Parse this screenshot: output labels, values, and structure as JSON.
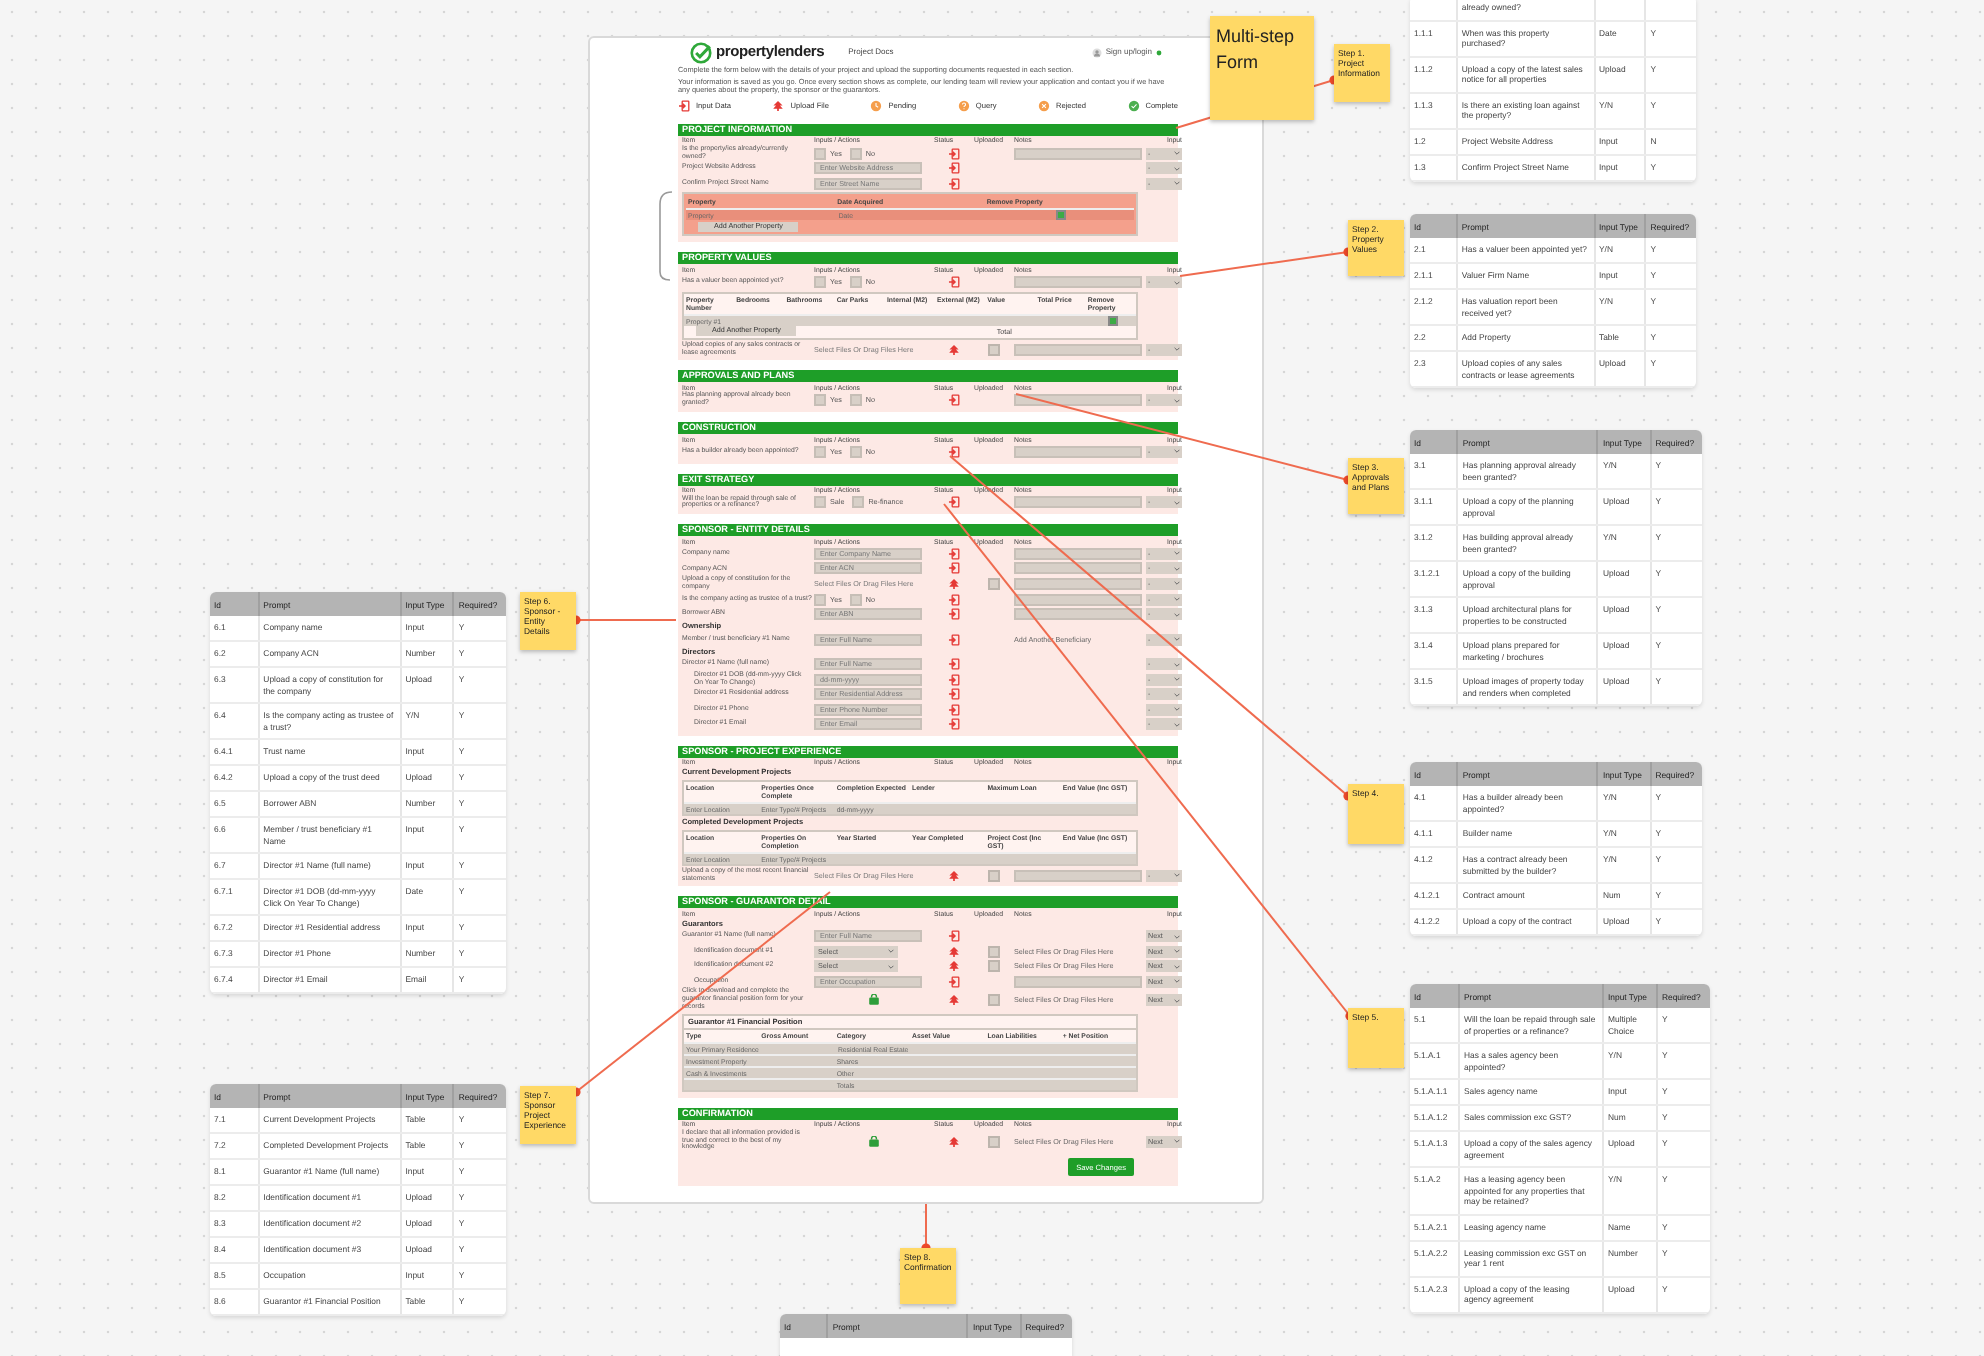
{
  "sticky_notes": [
    {
      "text": "Multi-step Form",
      "kind": "large"
    },
    {
      "text": "Step 1. Project Information",
      "kind": "small"
    },
    {
      "text": "Step 2. Property Values",
      "kind": "small"
    },
    {
      "text": "Step 3. Approvals and Plans",
      "kind": "small"
    },
    {
      "text": "Step 4.",
      "kind": "small"
    },
    {
      "text": "Step 5.",
      "kind": "small"
    },
    {
      "text": "Step 6. Sponsor - Entity Details",
      "kind": "small"
    },
    {
      "text": "Step 7. Sponsor Project Experience",
      "kind": "small"
    },
    {
      "text": "Step 8. Confirmation",
      "kind": "small"
    }
  ],
  "spec_tables": [
    {
      "rows": [
        [
          "",
          "already owned?",
          "",
          ""
        ],
        [
          "1.1.1",
          "When was this property purchased?",
          "Date",
          "Y"
        ],
        [
          "1.1.2",
          "Upload a copy of the latest sales notice for all properties",
          "Upload",
          "Y"
        ],
        [
          "1.1.3",
          "Is there an existing loan against the property?",
          "Y/N",
          "Y"
        ],
        [
          "1.2",
          "Project Website Address",
          "Input",
          "N"
        ],
        [
          "1.3",
          "Confirm Project Street Name",
          "Input",
          "Y"
        ]
      ]
    },
    {
      "columns": [
        "Id",
        "Prompt",
        "Input Type",
        "Required?"
      ],
      "rows": [
        [
          "2.1",
          "Has a valuer been appointed yet?",
          "Y/N",
          "Y"
        ],
        [
          "2.1.1",
          "Valuer Firm Name",
          "Input",
          "Y"
        ],
        [
          "2.1.2",
          "Has valuation report been received yet?",
          "Y/N",
          "Y"
        ],
        [
          "2.2",
          "Add Property",
          "Table",
          "Y"
        ],
        [
          "2.3",
          "Upload copies of any sales contracts or lease agreements",
          "Upload",
          "Y"
        ]
      ]
    },
    {
      "columns": [
        "Id",
        "Prompt",
        "Input Type",
        "Required?"
      ],
      "rows": [
        [
          "3.1",
          "Has planning approval already been granted?",
          "Y/N",
          "Y"
        ],
        [
          "3.1.1",
          "Upload a copy of the planning approval",
          "Upload",
          "Y"
        ],
        [
          "3.1.2",
          "Has building approval already been granted?",
          "Y/N",
          "Y"
        ],
        [
          "3.1.2.1",
          "Upload a copy of the building approval",
          "Upload",
          "Y"
        ],
        [
          "3.1.3",
          "Upload architectural plans for properties to be constructed",
          "Upload",
          "Y"
        ],
        [
          "3.1.4",
          "Upload plans prepared for marketing / brochures",
          "Upload",
          "Y"
        ],
        [
          "3.1.5",
          "Upload images of property today and renders when completed",
          "Upload",
          "Y"
        ]
      ]
    },
    {
      "columns": [
        "Id",
        "Prompt",
        "Input Type",
        "Required?"
      ],
      "rows": [
        [
          "4.1",
          "Has a builder already been appointed?",
          "Y/N",
          "Y"
        ],
        [
          "4.1.1",
          "Builder name",
          "Y/N",
          "Y"
        ],
        [
          "4.1.2",
          "Has a contract already been submitted by the builder?",
          "Y/N",
          "Y"
        ],
        [
          "4.1.2.1",
          "Contract amount",
          "Num",
          "Y"
        ],
        [
          "4.1.2.2",
          "Upload a copy of the contract",
          "Upload",
          "Y"
        ]
      ]
    },
    {
      "columns": [
        "Id",
        "Prompt",
        "Input Type",
        "Required?"
      ],
      "rows": [
        [
          "5.1",
          "Will the loan be repaid through sale of properties or a refinance?",
          "Multiple Choice",
          "Y"
        ],
        [
          "5.1.A.1",
          "Has a sales agency been appointed?",
          "Y/N",
          "Y"
        ],
        [
          "5.1.A.1.1",
          "Sales agency name",
          "Input",
          "Y"
        ],
        [
          "5.1.A.1.2",
          "Sales commission exc GST?",
          "Num",
          "Y"
        ],
        [
          "5.1.A.1.3",
          "Upload a copy of the sales agency agreement",
          "Upload",
          "Y"
        ],
        [
          "5.1.A.2",
          "Has a leasing agency been appointed for any properties that may be retained?",
          "Y/N",
          "Y"
        ],
        [
          "5.1.A.2.1",
          "Leasing agency name",
          "Name",
          "Y"
        ],
        [
          "5.1.A.2.2",
          "Leasing commission exc GST on year 1 rent",
          "Number",
          "Y"
        ],
        [
          "5.1.A.2.3",
          "Upload a copy of the leasing agency agreement",
          "Upload",
          "Y"
        ]
      ]
    },
    {
      "columns": [
        "Id",
        "Prompt",
        "Input Type",
        "Required?"
      ],
      "rows": [
        [
          "6.1",
          "Company name",
          "Input",
          "Y"
        ],
        [
          "6.2",
          "Company ACN",
          "Number",
          "Y"
        ],
        [
          "6.3",
          "Upload a copy of constitution for the company",
          "Upload",
          "Y"
        ],
        [
          "6.4",
          "Is the company acting as trustee of a trust?",
          "Y/N",
          "Y"
        ],
        [
          "6.4.1",
          "Trust name",
          "Input",
          "Y"
        ],
        [
          "6.4.2",
          "Upload a copy of the trust deed",
          "Upload",
          "Y"
        ],
        [
          "6.5",
          "Borrower ABN",
          "Number",
          "Y"
        ],
        [
          "6.6",
          "Member / trust beneficiary #1 Name",
          "Input",
          "Y"
        ],
        [
          "6.7",
          "Director #1 Name (full name)",
          "Input",
          "Y"
        ],
        [
          "6.7.1",
          "Director #1 DOB (dd-mm-yyyy Click On Year To Change)",
          "Date",
          "Y"
        ],
        [
          "6.7.2",
          "Director #1 Residential address",
          "Input",
          "Y"
        ],
        [
          "6.7.3",
          "Director #1 Phone",
          "Number",
          "Y"
        ],
        [
          "6.7.4",
          "Director #1 Email",
          "Email",
          "Y"
        ]
      ]
    },
    {
      "columns": [
        "Id",
        "Prompt",
        "Input Type",
        "Required?"
      ],
      "rows": [
        [
          "7.1",
          "Current Development Projects",
          "Table",
          "Y"
        ],
        [
          "7.2",
          "Completed Development Projects",
          "Table",
          "Y"
        ],
        [
          "8.1",
          "Guarantor #1 Name (full name)",
          "Input",
          "Y"
        ],
        [
          "8.2",
          "Identification document #1",
          "Upload",
          "Y"
        ],
        [
          "8.3",
          "Identification document #2",
          "Upload",
          "Y"
        ],
        [
          "8.4",
          "Identification document #3",
          "Upload",
          "Y"
        ],
        [
          "8.5",
          "Occupation",
          "Input",
          "Y"
        ],
        [
          "8.6",
          "Guarantor #1 Financial Position",
          "Table",
          "Y"
        ]
      ]
    },
    {
      "columns": [
        "Id",
        "Prompt",
        "Input Type",
        "Required?"
      ]
    }
  ],
  "form": {
    "logo": "propertylenders",
    "nav": "Project Docs",
    "account": "Sign up/login",
    "intro": [
      "Complete the form below with the details of your project and upload the supporting documents requested in each section.",
      "Your information is saved as you go. Once every section shows as complete, our lending team will review your application and contact you if we have any queries about the property, the sponsor or the guarantors."
    ],
    "legend": [
      {
        "label": "Input Data",
        "kind": "input"
      },
      {
        "label": "Upload File",
        "kind": "upload"
      },
      {
        "label": "Pending",
        "kind": "pending"
      },
      {
        "label": "Query",
        "kind": "query"
      },
      {
        "label": "Rejected",
        "kind": "rejected"
      },
      {
        "label": "Complete",
        "kind": "complete"
      }
    ],
    "sections": [
      {
        "title": "PROJECT INFORMATION",
        "columns": [
          "Item",
          "Inputs / Actions",
          "Status",
          "Uploaded",
          "Notes",
          "Input"
        ],
        "rows": [
          {
            "kind": "yesno",
            "label": "Is the property/ies already/currently owned?",
            "options": [
              "Yes",
              "No"
            ],
            "status": {
              "kind": "input"
            },
            "notes": true,
            "input": "-"
          },
          {
            "kind": "field",
            "label": "Project Website Address",
            "placeholder": "Enter Website Address",
            "status": {
              "kind": "input"
            },
            "input": "-"
          },
          {
            "kind": "field",
            "label": "Confirm Project Street Name",
            "placeholder": "Enter Street Name",
            "status": {
              "kind": "input"
            },
            "input": "-"
          },
          {
            "kind": "table",
            "highlight": true,
            "columns": [
              "Property",
              "Date Acquired",
              "Remove Property"
            ],
            "rows": [
              {
                "cells": [
                  "Property",
                  "Date"
                ],
                "remove": true
              }
            ],
            "button": "Add Another Property"
          }
        ]
      },
      {
        "title": "PROPERTY VALUES",
        "columns": [
          "Item",
          "Inputs / Actions",
          "Status",
          "Uploaded",
          "Notes",
          "Input"
        ],
        "rows": [
          {
            "kind": "yesno",
            "label": "Has a valuer been appointed yet?",
            "options": [
              "Yes",
              "No"
            ],
            "status": {
              "kind": "input"
            },
            "notes": true,
            "input": "-"
          },
          {
            "kind": "table",
            "highlight": false,
            "columns": [
              "Property Number",
              "Bedrooms",
              "Bathrooms",
              "Car Parks",
              "Internal (M2)",
              "External (M2)",
              "Value",
              "Total Price",
              "Remove Property"
            ],
            "rows": [
              {
                "cells": [
                  "Property #1",
                  "",
                  "",
                  "",
                  "",
                  "",
                  "",
                  ""
                ],
                "remove": true
              }
            ],
            "button": "Add Another Property",
            "total": "Total"
          },
          {
            "kind": "upload",
            "label": "Upload copies of any sales contracts or lease agreements",
            "action": "Select Files Or Drag Files Here",
            "status": {
              "kind": "upload"
            },
            "uploaded": false,
            "notes": true,
            "input": "-"
          }
        ]
      },
      {
        "title": "APPROVALS AND PLANS",
        "columns": [
          "Item",
          "Inputs / Actions",
          "Status",
          "Uploaded",
          "Notes",
          "Input"
        ],
        "rows": [
          {
            "kind": "yesno",
            "label": "Has planning approval already been granted?",
            "options": [
              "Yes",
              "No"
            ],
            "status": {
              "kind": "input"
            },
            "notes": true,
            "input": "-"
          }
        ]
      },
      {
        "title": "CONSTRUCTION",
        "columns": [
          "Item",
          "Inputs / Actions",
          "Status",
          "Uploaded",
          "Notes",
          "Input"
        ],
        "rows": [
          {
            "kind": "yesno",
            "label": "Has a builder already been appointed?",
            "options": [
              "Yes",
              "No"
            ],
            "status": {
              "kind": "input"
            },
            "notes": true,
            "input": "-"
          }
        ]
      },
      {
        "title": "EXIT STRATEGY",
        "columns": [
          "Item",
          "Inputs / Actions",
          "Status",
          "Uploaded",
          "Notes",
          "Input"
        ],
        "rows": [
          {
            "kind": "yesno",
            "label": "Will the loan be repaid through sale of properties or a refinance?",
            "options": [
              "Sale",
              "Re-finance"
            ],
            "status": {
              "kind": "input"
            },
            "notes": true,
            "input": "-"
          }
        ]
      },
      {
        "title": "SPONSOR - ENTITY DETAILS",
        "columns": [
          "Item",
          "Inputs / Actions",
          "Status",
          "Uploaded",
          "Notes",
          "Input"
        ],
        "rows": [
          {
            "kind": "field",
            "label": "Company name",
            "placeholder": "Enter Company Name",
            "status": {
              "kind": "input"
            },
            "notes": true,
            "input": "-"
          },
          {
            "kind": "field",
            "label": "Company ACN",
            "placeholder": "Enter ACN",
            "status": {
              "kind": "input"
            },
            "notes": true,
            "input": "-"
          },
          {
            "kind": "upload",
            "label": "Upload a copy of constitution for the company",
            "action": "Select Files Or Drag Files Here",
            "status": {
              "kind": "upload"
            },
            "uploaded": false,
            "notes": true,
            "input": "-"
          },
          {
            "kind": "yesno",
            "label": "Is the company acting as trustee of a trust?",
            "options": [
              "Yes",
              "No"
            ],
            "status": {
              "kind": "input"
            },
            "notes": true,
            "input": "-"
          },
          {
            "kind": "field",
            "label": "Borrower ABN",
            "placeholder": "Enter ABN",
            "status": {
              "kind": "input"
            },
            "notes": true,
            "input": "-"
          },
          {
            "kind": "heading",
            "label": "Ownership"
          },
          {
            "kind": "field",
            "label": "Member / trust beneficiary #1 Name",
            "placeholder": "Enter Full Name",
            "status": {
              "kind": "input"
            },
            "note": "Add Another Beneficiary",
            "input": "-"
          },
          {
            "kind": "heading",
            "label": "Directors"
          },
          {
            "kind": "field",
            "label": "Director #1 Name (full name)",
            "placeholder": "Enter Full Name",
            "status": {
              "kind": "input"
            },
            "input": "-",
            "children": [
              {
                "kind": "field",
                "label": "Director #1 DOB (dd-mm-yyyy Click On Year To Change)",
                "placeholder": "dd-mm-yyyy",
                "status": {
                  "kind": "input"
                },
                "input": "-"
              },
              {
                "kind": "field",
                "label": "Director #1 Residential address",
                "placeholder": "Enter Residential Address",
                "status": {
                  "kind": "input"
                },
                "input": "-"
              },
              {
                "kind": "field",
                "label": "Director #1 Phone",
                "placeholder": "Enter Phone Number",
                "status": {
                  "kind": "input"
                },
                "input": "-"
              },
              {
                "kind": "field",
                "label": "Director #1 Email",
                "placeholder": "Enter Email",
                "status": {
                  "kind": "input"
                },
                "input": "-"
              }
            ]
          }
        ]
      },
      {
        "title": "SPONSOR - PROJECT EXPERIENCE",
        "columns": [
          "Item",
          "Inputs / Actions",
          "Status",
          "Uploaded",
          "Notes",
          "Input"
        ],
        "rows": [
          {
            "kind": "heading",
            "label": "Current Development Projects"
          },
          {
            "kind": "table",
            "highlight": false,
            "columns": [
              "Location",
              "Properties Once Complete",
              "Completion Expected",
              "Lender",
              "Maximum Loan",
              "End Value (Inc GST)"
            ],
            "rows": [
              {
                "cells": [
                  "Enter Location",
                  "Enter Type/# Projects",
                  "dd-mm-yyyy",
                  "",
                  "",
                  ""
                ]
              }
            ]
          },
          {
            "kind": "heading",
            "label": "Completed Development Projects"
          },
          {
            "kind": "table",
            "highlight": false,
            "columns": [
              "Location",
              "Properties On Completion",
              "Year Started",
              "Year Completed",
              "Project Cost (Inc GST)",
              "End Value (Inc GST)"
            ],
            "rows": [
              {
                "cells": [
                  "Enter Location",
                  "Enter Type/# Projects",
                  "",
                  "",
                  "",
                  ""
                ]
              }
            ]
          },
          {
            "kind": "upload",
            "label": "Upload a copy of the most recent financial statements",
            "action": "Select Files Or Drag Files Here",
            "status": {
              "kind": "upload"
            },
            "uploaded": false,
            "notes": true,
            "input": "-"
          }
        ]
      },
      {
        "title": "SPONSOR - GUARANTOR DETAIL",
        "columns": [
          "Item",
          "Inputs / Actions",
          "Status",
          "Uploaded",
          "Notes",
          "Input"
        ],
        "rows": [
          {
            "kind": "heading",
            "label": "Guarantors"
          },
          {
            "kind": "field",
            "label": "Guarantor #1 Name (full name)",
            "placeholder": "Enter Full Name",
            "status": {
              "kind": "input"
            },
            "input": "Next",
            "children": [
              {
                "kind": "select",
                "label": "Identification document #1",
                "value": "Select",
                "status": {
                  "kind": "upload"
                },
                "uploaded": false,
                "note": "Select Files Or Drag Files Here",
                "input": "Next"
              },
              {
                "kind": "select",
                "label": "Identification document #2",
                "value": "Select",
                "status": {
                  "kind": "upload"
                },
                "uploaded": false,
                "note": "Select Files Or Drag Files Here",
                "input": "Next"
              },
              {
                "kind": "field",
                "label": "Occupation",
                "placeholder": "Enter Occupation",
                "status": {
                  "kind": "input"
                },
                "notes": true,
                "input": "Next"
              }
            ]
          },
          {
            "kind": "download",
            "label": "Click to download and complete the guarantor financial position form for your records",
            "status": {
              "kind": "upload"
            },
            "uploaded": false,
            "note": "Select Files Or Drag Files Here",
            "input": "Next"
          },
          {
            "kind": "table",
            "highlight": false,
            "title": "Guarantor #1 Financial Position",
            "columns": [
              "Type",
              "Gross Amount",
              "Category",
              "Asset Value",
              "Loan Liabilities",
              "+ Net Position"
            ],
            "rows": [
              {
                "cells": [
                  "Your Primary Residence",
                  "",
                  "Residential Real Estate",
                  "",
                  "",
                  ""
                ]
              },
              {
                "cells": [
                  "Investment Property",
                  "",
                  "Shares",
                  "",
                  "",
                  ""
                ]
              },
              {
                "cells": [
                  "Cash & Investments",
                  "",
                  "Other",
                  "",
                  "",
                  ""
                ]
              },
              {
                "cells": [
                  "",
                  "",
                  "Totals",
                  "",
                  "",
                  ""
                ]
              }
            ]
          }
        ]
      },
      {
        "title": "CONFIRMATION",
        "columns": [
          "Item",
          "Inputs / Actions",
          "Status",
          "Uploaded",
          "Notes",
          "Input"
        ],
        "rows": [
          {
            "kind": "download",
            "label": "I declare that all information provided is true and correct to the best of my knowledge",
            "status": {
              "kind": "upload"
            },
            "uploaded": false,
            "note": "Select Files Or Drag Files Here",
            "input": "Next"
          }
        ],
        "button": "Save Changes"
      }
    ]
  }
}
